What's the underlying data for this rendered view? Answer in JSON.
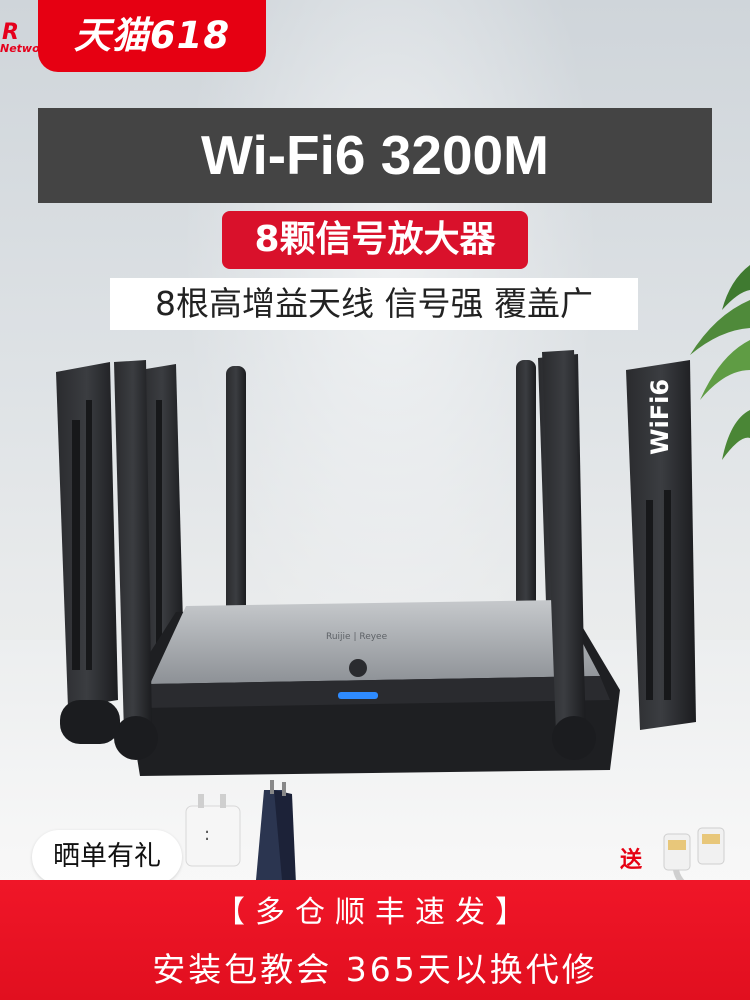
{
  "badge": {
    "label": "天猫618"
  },
  "brand": {
    "mark": "R",
    "text": "Networks"
  },
  "headline": {
    "title": "Wi-Fi6 3200M"
  },
  "highlight": {
    "red_tag": "8颗信号放大器",
    "white_tag": "8根高增益天线 信号强 覆盖广"
  },
  "product": {
    "antenna_print": "WiFi6",
    "lid_print": "Ruijie | Reyee"
  },
  "promo": {
    "share_label": "晒单有礼",
    "send_label": "送"
  },
  "banner": {
    "shipping": "【多仓顺丰速发】",
    "service": "安装包教会 365天以换代修"
  },
  "colors": {
    "accent_red": "#e60012",
    "title_bar": "#444444",
    "router_body": "#1e1f22",
    "led_blue": "#2e8bff"
  }
}
